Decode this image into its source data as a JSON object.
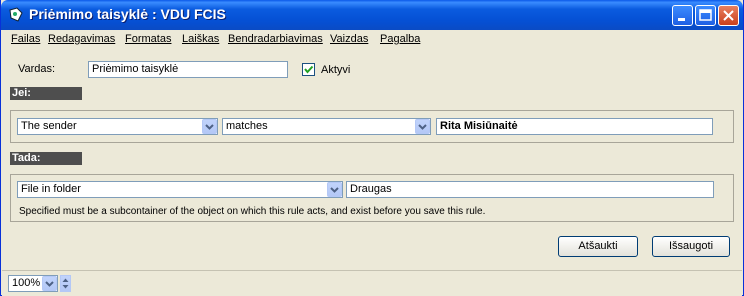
{
  "window": {
    "title": "Priėmimo taisyklė : VDU FCIS"
  },
  "menu": [
    "Failas",
    "Redagavimas",
    "Formatas",
    "Laiškas",
    "Bendradarbiavimas",
    "Vaizdas",
    "Pagalba"
  ],
  "rule": {
    "name_label": "Vardas:",
    "name_value": "Priėmimo taisyklė",
    "active_label": "Aktyvi",
    "active_checked": true
  },
  "if_section": {
    "header": "Jei:",
    "field": "The sender",
    "operator": "matches",
    "value": "Rita Misiūnaitė"
  },
  "then_section": {
    "header": "Tada:",
    "action": "File in folder",
    "target": "Draugas",
    "hint": "Specified must be a subcontainer of the object on which this rule acts, and exist before you save this rule."
  },
  "buttons": {
    "cancel": "Atšaukti",
    "save": "Išsaugoti"
  },
  "status": {
    "zoom": "100%"
  }
}
